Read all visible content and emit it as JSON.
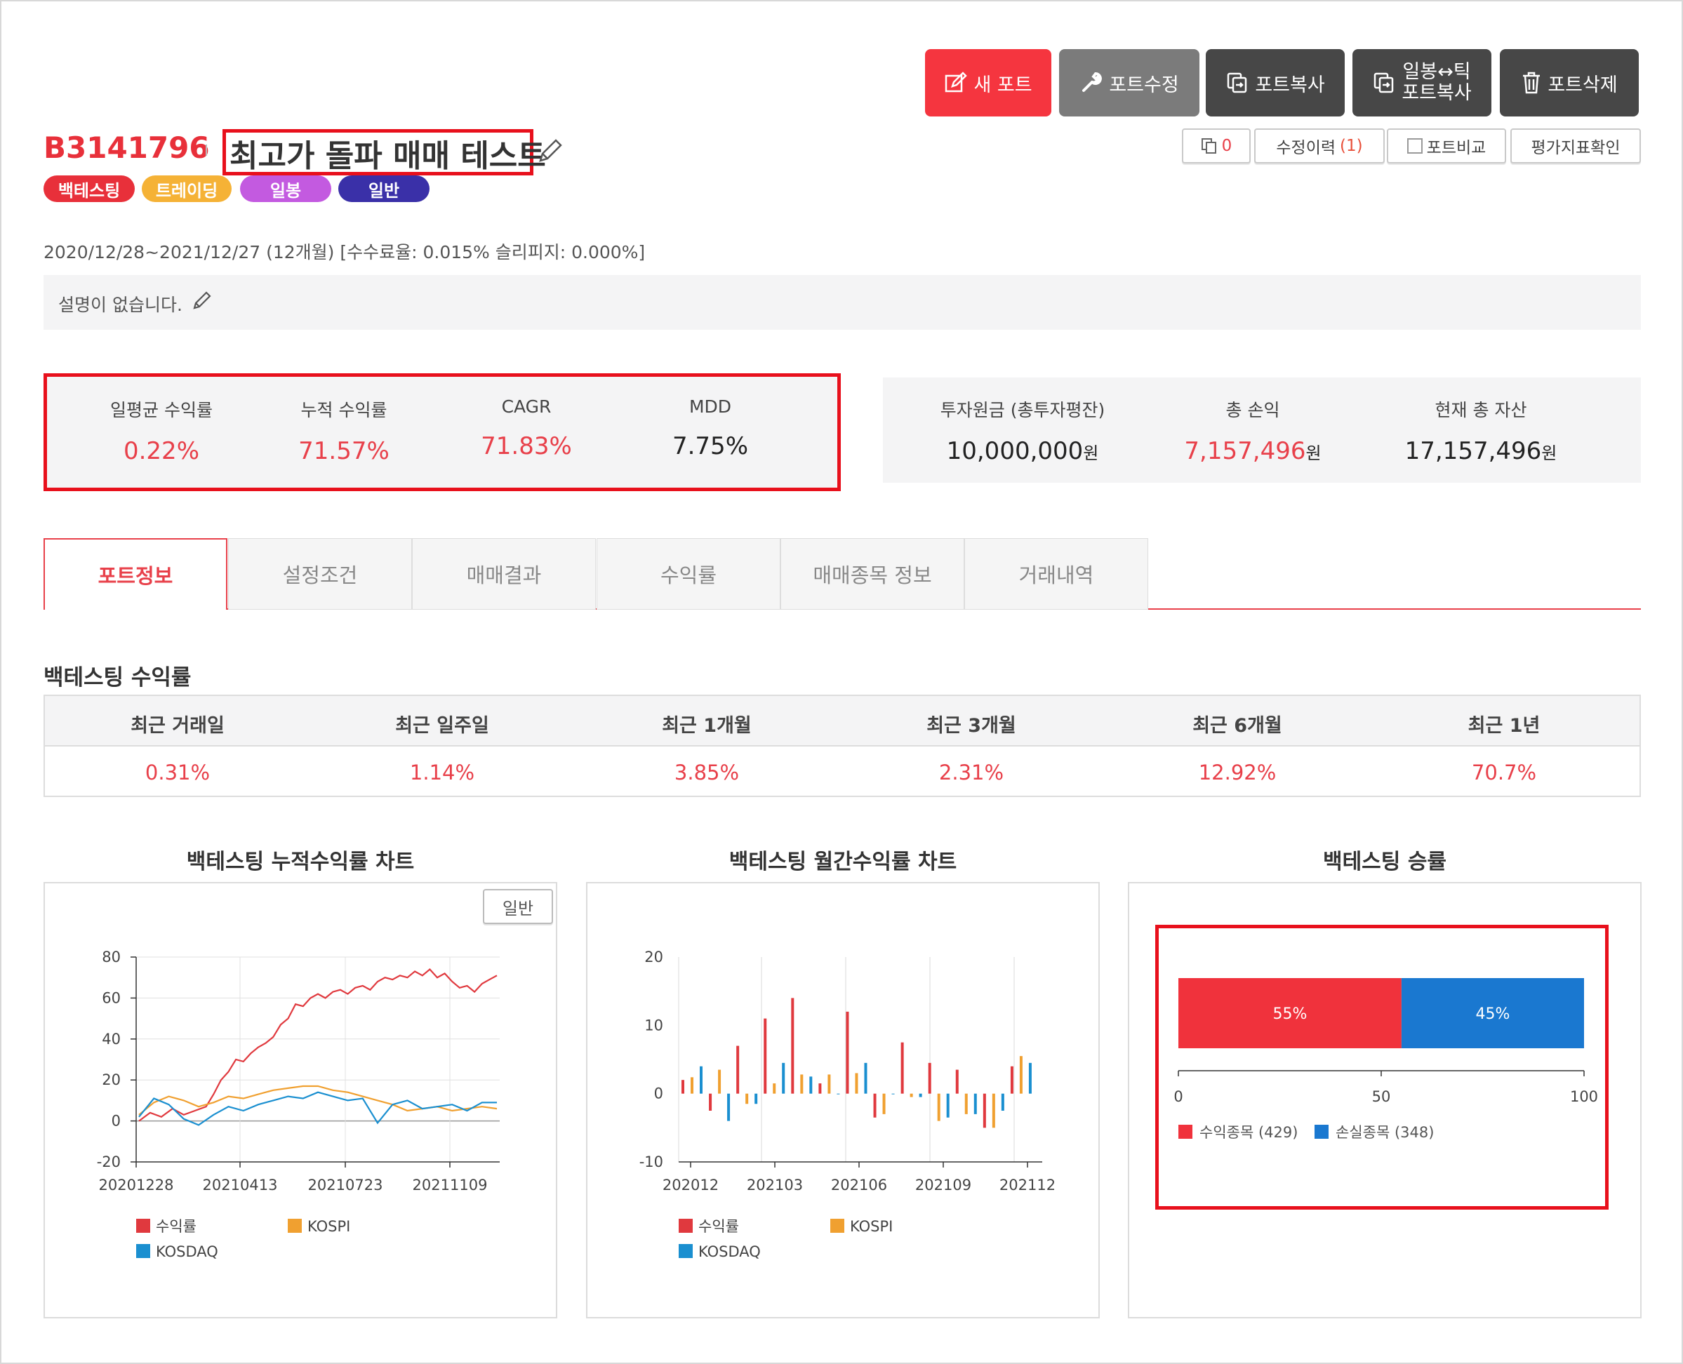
{
  "toolbar": {
    "new_port": "새 포트",
    "edit_port": "포트수정",
    "copy_port": "포트복사",
    "tick_copy_line1": "일봉↔틱",
    "tick_copy_line2": "포트복사",
    "delete_port": "포트삭제"
  },
  "subtoolbar": {
    "copy_count": "0",
    "history_label": "수정이력",
    "history_count": "(1)",
    "compare_label": "포트비교",
    "evaluate_label": "평가지표확인"
  },
  "portfolio": {
    "id": "B3141796",
    "name": "최고가 돌파 매매 테스트",
    "badges": [
      {
        "label": "백테스팅",
        "color": "#e8303a"
      },
      {
        "label": "트레이딩",
        "color": "#f5b236"
      },
      {
        "label": "일봉",
        "color": "#c35ae0"
      },
      {
        "label": "일반",
        "color": "#3a30a8"
      }
    ],
    "period_info": "2020/12/28~2021/12/27 (12개월) [수수료율: 0.015% 슬리피지: 0.000%]",
    "description": "설명이 없습니다."
  },
  "metrics": [
    {
      "label": "일평균 수익률",
      "value": "0.22%"
    },
    {
      "label": "누적 수익률",
      "value": "71.57%"
    },
    {
      "label": "CAGR",
      "value": "71.83%"
    },
    {
      "label": "MDD",
      "value": "7.75%"
    }
  ],
  "assets": [
    {
      "label": "투자원금 (총투자평잔)",
      "value": "10,000,000",
      "unit": "원"
    },
    {
      "label": "총 손익",
      "value": "7,157,496",
      "unit": "원"
    },
    {
      "label": "현재 총 자산",
      "value": "17,157,496",
      "unit": "원"
    }
  ],
  "tabs": [
    "포트정보",
    "설정조건",
    "매매결과",
    "수익률",
    "매매종목 정보",
    "거래내역"
  ],
  "period_returns": {
    "title": "백테스팅 수익률",
    "headers": [
      "최근 거래일",
      "최근 일주일",
      "최근 1개월",
      "최근 3개월",
      "최근 6개월",
      "최근 1년"
    ],
    "values": [
      "0.31%",
      "1.14%",
      "3.85%",
      "2.31%",
      "12.92%",
      "70.7%"
    ]
  },
  "charts": {
    "cumulative_title": "백테스팅 누적수익률 차트",
    "cumulative_toggle": "일반",
    "monthly_title": "백테스팅 월간수익률 차트",
    "winrate_title": "백테스팅 승률"
  },
  "colors": {
    "return": "#e0393e",
    "kospi": "#f0a030",
    "kosdaq": "#1a8fd0",
    "accent": "#e8404a",
    "win": "#f0323c",
    "loss": "#1a78d0"
  },
  "chart_data": [
    {
      "type": "line",
      "title": "백테스팅 누적수익률 차트",
      "x_ticks": [
        "20201228",
        "20210413",
        "20210723",
        "20211109"
      ],
      "ylim": [
        -20,
        80
      ],
      "y_ticks": [
        "80",
        "60",
        "40",
        "20",
        "0",
        "-20"
      ],
      "series": [
        {
          "name": "수익률",
          "points": [
            [
              0,
              0
            ],
            [
              3,
              4
            ],
            [
              6,
              2
            ],
            [
              9,
              6
            ],
            [
              12,
              3
            ],
            [
              15,
              5
            ],
            [
              18,
              7
            ],
            [
              20,
              13
            ],
            [
              22,
              20
            ],
            [
              24,
              24
            ],
            [
              26,
              30
            ],
            [
              28,
              29
            ],
            [
              30,
              33
            ],
            [
              32,
              36
            ],
            [
              34,
              38
            ],
            [
              36,
              41
            ],
            [
              38,
              47
            ],
            [
              40,
              50
            ],
            [
              42,
              57
            ],
            [
              44,
              56
            ],
            [
              46,
              60
            ],
            [
              48,
              62
            ],
            [
              50,
              60
            ],
            [
              52,
              63
            ],
            [
              54,
              64
            ],
            [
              56,
              62
            ],
            [
              58,
              65
            ],
            [
              60,
              66
            ],
            [
              62,
              64
            ],
            [
              64,
              68
            ],
            [
              66,
              70
            ],
            [
              68,
              69
            ],
            [
              70,
              71
            ],
            [
              72,
              70
            ],
            [
              74,
              73
            ],
            [
              76,
              71
            ],
            [
              78,
              74
            ],
            [
              80,
              70
            ],
            [
              82,
              72
            ],
            [
              84,
              68
            ],
            [
              86,
              65
            ],
            [
              88,
              66
            ],
            [
              90,
              63
            ],
            [
              92,
              67
            ],
            [
              94,
              69
            ],
            [
              96,
              71
            ]
          ]
        },
        {
          "name": "KOSPI",
          "points": [
            [
              0,
              3
            ],
            [
              4,
              9
            ],
            [
              8,
              12
            ],
            [
              12,
              10
            ],
            [
              16,
              7
            ],
            [
              20,
              9
            ],
            [
              24,
              12
            ],
            [
              28,
              11
            ],
            [
              32,
              13
            ],
            [
              36,
              15
            ],
            [
              40,
              16
            ],
            [
              44,
              17
            ],
            [
              48,
              17
            ],
            [
              52,
              15
            ],
            [
              56,
              14
            ],
            [
              60,
              12
            ],
            [
              64,
              10
            ],
            [
              68,
              8
            ],
            [
              72,
              5
            ],
            [
              76,
              6
            ],
            [
              80,
              7
            ],
            [
              84,
              5
            ],
            [
              88,
              6
            ],
            [
              92,
              7
            ],
            [
              96,
              6
            ]
          ]
        },
        {
          "name": "KOSDAQ",
          "points": [
            [
              0,
              2
            ],
            [
              4,
              11
            ],
            [
              8,
              8
            ],
            [
              12,
              1
            ],
            [
              16,
              -2
            ],
            [
              20,
              3
            ],
            [
              24,
              7
            ],
            [
              28,
              5
            ],
            [
              32,
              8
            ],
            [
              36,
              10
            ],
            [
              40,
              12
            ],
            [
              44,
              11
            ],
            [
              48,
              14
            ],
            [
              52,
              12
            ],
            [
              56,
              10
            ],
            [
              60,
              11
            ],
            [
              64,
              -1
            ],
            [
              68,
              8
            ],
            [
              72,
              10
            ],
            [
              76,
              6
            ],
            [
              80,
              7
            ],
            [
              84,
              8
            ],
            [
              88,
              5
            ],
            [
              92,
              9
            ],
            [
              96,
              9
            ]
          ]
        }
      ]
    },
    {
      "type": "bar",
      "title": "백테스팅 월간수익률 차트",
      "x_ticks": [
        "202012",
        "202103",
        "202106",
        "202109",
        "202112"
      ],
      "categories": [
        "202012",
        "202101",
        "202102",
        "202103",
        "202104",
        "202105",
        "202106",
        "202107",
        "202108",
        "202109",
        "202110",
        "202111",
        "202112"
      ],
      "ylim": [
        -10,
        20
      ],
      "y_ticks": [
        "20",
        "10",
        "0",
        "-10"
      ],
      "series": [
        {
          "name": "수익률",
          "values": [
            2,
            -2.5,
            7,
            11,
            14,
            1.5,
            12,
            -3.5,
            7.5,
            4.5,
            3.5,
            -5,
            4
          ]
        },
        {
          "name": "KOSPI",
          "values": [
            2.4,
            3.5,
            -1.5,
            1.5,
            2.8,
            2.8,
            3,
            -3,
            -0.5,
            -4,
            -3,
            -5,
            5.5
          ]
        },
        {
          "name": "KOSDAQ",
          "values": [
            4,
            -4,
            -1.5,
            4.5,
            2.5,
            0,
            4.5,
            0,
            -0.5,
            -3.5,
            -3,
            -2.5,
            4.5
          ]
        }
      ]
    },
    {
      "type": "bar",
      "title": "백테스팅 승률",
      "orientation": "horizontal-stacked",
      "xlim": [
        0,
        100
      ],
      "x_ticks": [
        "0",
        "50",
        "100"
      ],
      "series": [
        {
          "name": "수익종목 (429)",
          "value": 55,
          "label": "55%"
        },
        {
          "name": "손실종목 (348)",
          "value": 45,
          "label": "45%"
        }
      ]
    }
  ]
}
